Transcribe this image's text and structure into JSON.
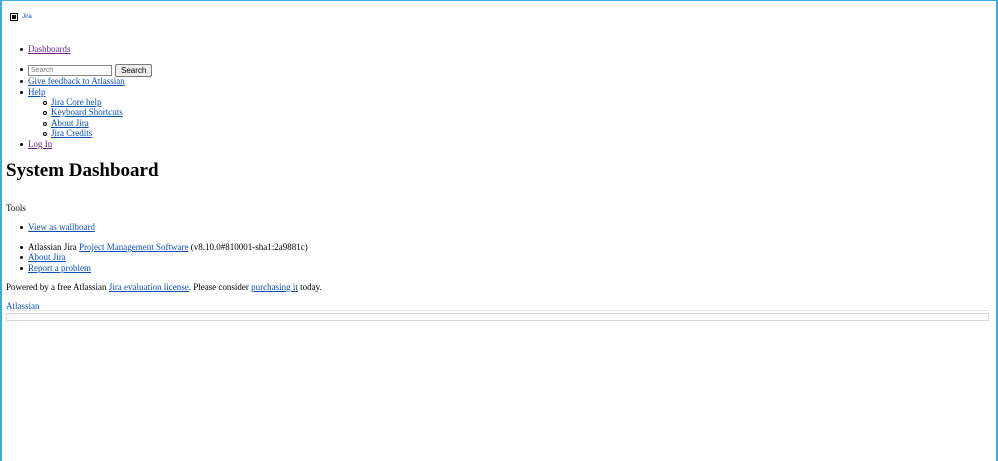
{
  "header": {
    "logo_label": "Jira"
  },
  "nav": {
    "dashboards": "Dashboards"
  },
  "search": {
    "placeholder": "Search",
    "button": "Search"
  },
  "menu": {
    "feedback": "Give feedback to Atlassian",
    "help": "Help",
    "help_items": [
      "Jira Core help",
      "Keyboard Shortcuts",
      "About Jira",
      "Jira Credits"
    ],
    "login": "Log In"
  },
  "page": {
    "title": "System Dashboard",
    "tools_label": "Tools",
    "wallboard": "View as wallboard"
  },
  "footer": {
    "version_prefix": "Atlassian Jira",
    "version_link": "Project Management Software",
    "version_suffix": "(v8.10.0#810001-sha1:2a9881c)",
    "about": "About Jira",
    "report": "Report a problem",
    "powered_prefix": "Powered by a free Atlassian",
    "license_link": "Jira evaluation license",
    "powered_middle": ". Please consider",
    "purchase_link": "purchasing it",
    "powered_suffix": "today.",
    "atlassian": "Atlassian"
  },
  "colors": {
    "link": "#0b4fb0",
    "visited": "#6b1e87",
    "frame": "#3fa9e0"
  }
}
